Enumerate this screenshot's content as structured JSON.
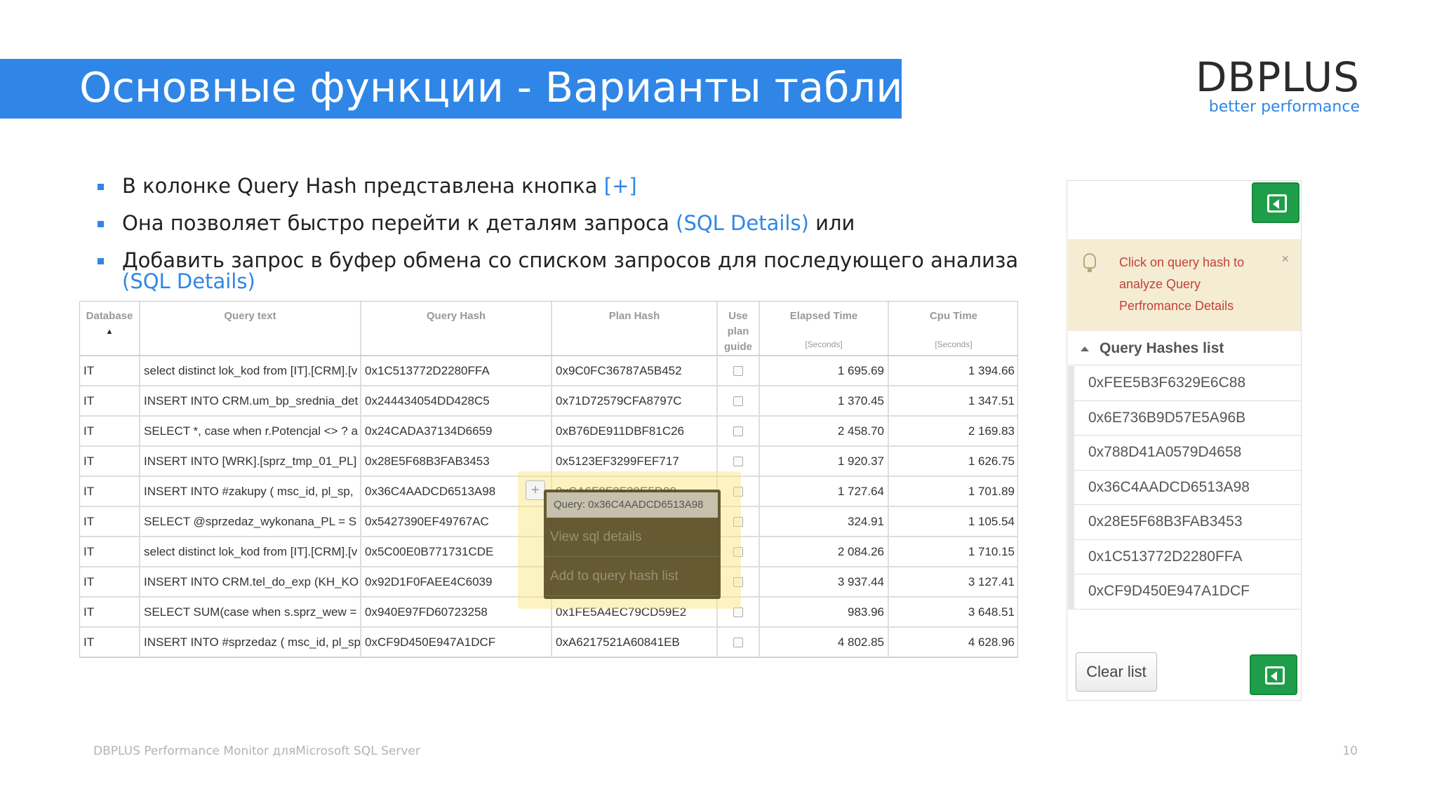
{
  "slide": {
    "title": "Основные функции - Варианты таблиц",
    "logo_main": "DBPLUS",
    "logo_sub": "better performance",
    "footer": "DBPLUS Performance Monitor дляMicrosoft SQL Server",
    "page_number": "10",
    "accent_color": "#2f86e6"
  },
  "bullets": [
    {
      "text": "В колонке Query Hash представлена кнопка ",
      "highlight": "[+]",
      "suffix": ""
    },
    {
      "text": "Она позволяет быстро перейти к деталям запроса ",
      "highlight": "(SQL Details)",
      "suffix": " или"
    },
    {
      "text": "Добавить запрос в буфер обмена со списком запросов для последующего анализа ",
      "highlight": "(SQL Details)",
      "suffix": ""
    }
  ],
  "table": {
    "columns": {
      "database": "Database",
      "query_text": "Query text",
      "query_hash": "Query Hash",
      "plan_hash": "Plan Hash",
      "use_plan_guide_1": "Use",
      "use_plan_guide_2": "plan",
      "use_plan_guide_3": "guide",
      "elapsed_time": "Elapsed Time",
      "elapsed_unit": "[Seconds]",
      "cpu_time": "Cpu Time",
      "cpu_unit": "[Seconds]"
    },
    "rows": [
      {
        "db": "IT",
        "query": "select distinct lok_kod from [IT].[CRM].[v",
        "qhash": "0x1C513772D2280FFA",
        "phash": "0x9C0FC36787A5B452",
        "elapsed": "1 695.69",
        "cpu": "1 394.66"
      },
      {
        "db": "IT",
        "query": "INSERT INTO CRM.um_bp_srednia_det",
        "qhash": "0x244434054DD428C5",
        "phash": "0x71D72579CFA8797C",
        "elapsed": "1 370.45",
        "cpu": "1 347.51"
      },
      {
        "db": "IT",
        "query": "SELECT *, case when r.Potencjal <> ? a",
        "qhash": "0x24CADA37134D6659",
        "phash": "0xB76DE911DBF81C26",
        "elapsed": "2 458.70",
        "cpu": "2 169.83"
      },
      {
        "db": "IT",
        "query": "INSERT INTO [WRK].[sprz_tmp_01_PL]",
        "qhash": "0x28E5F68B3FAB3453",
        "phash": "0x5123EF3299FEF717",
        "elapsed": "1 920.37",
        "cpu": "1 626.75"
      },
      {
        "db": "IT",
        "query": "INSERT INTO #zakupy ( msc_id, pl_sp,",
        "qhash": "0x36C4AADCD6513A98",
        "phash": "0xCA6F8F2F39E5D90",
        "elapsed": "1 727.64",
        "cpu": "1 701.89"
      },
      {
        "db": "IT",
        "query": "SELECT @sprzedaz_wykonana_PL = S",
        "qhash": "0x5427390EF49767AC",
        "phash": "",
        "elapsed": "324.91",
        "cpu": "1 105.54"
      },
      {
        "db": "IT",
        "query": "select distinct lok_kod from [IT].[CRM].[v",
        "qhash": "0x5C00E0B771731CDE",
        "phash": "",
        "elapsed": "2 084.26",
        "cpu": "1 710.15"
      },
      {
        "db": "IT",
        "query": "INSERT INTO CRM.tel_do_exp (KH_KO",
        "qhash": "0x92D1F0FAEE4C6039",
        "phash": "",
        "elapsed": "3 937.44",
        "cpu": "3 127.41"
      },
      {
        "db": "IT",
        "query": "SELECT SUM(case when s.sprz_wew =",
        "qhash": "0x940E97FD60723258",
        "phash": "0x1FE5A4EC79CD59E2",
        "elapsed": "983.96",
        "cpu": "3 648.51"
      },
      {
        "db": "IT",
        "query": "INSERT INTO #sprzedaz ( msc_id, pl_sp",
        "qhash": "0xCF9D450E947A1DCF",
        "phash": "0xA6217521A60841EB",
        "elapsed": "4 802.85",
        "cpu": "4 628.96"
      }
    ]
  },
  "popup": {
    "plus_label": "+",
    "header": "Query: 0x36C4AADCD6513A98",
    "view_details": "View sql details",
    "add_to_list": "Add to query hash list"
  },
  "panel": {
    "alert_text": "Click on query hash to analyze Query Perfromance Details",
    "alert_close": "×",
    "list_title": "Query Hashes list",
    "hashes": [
      "0xFEE5B3F6329E6C88",
      "0x6E736B9D57E5A96B",
      "0x788D41A0579D4658",
      "0x36C4AADCD6513A98",
      "0x28E5F68B3FAB3453",
      "0x1C513772D2280FFA",
      "0xCF9D450E947A1DCF"
    ],
    "clear_label": "Clear list",
    "export_icon": "excel-export-icon",
    "export_color": "#1e9e48"
  }
}
